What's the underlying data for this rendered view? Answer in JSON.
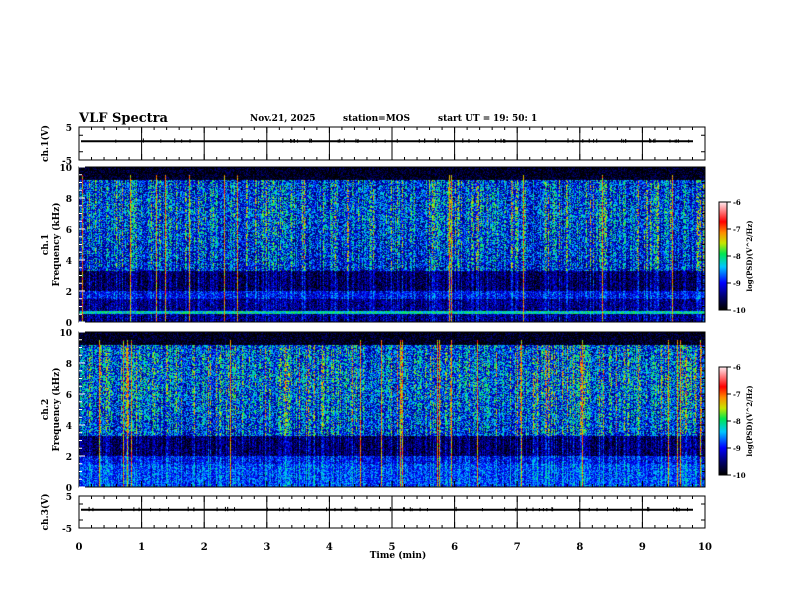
{
  "header": {
    "title": "VLF Spectra",
    "date": "Nov.21, 2025",
    "station": "station=MOS",
    "start_label": "start  UT =",
    "start_time": "19: 50: 1"
  },
  "chart_data": [
    {
      "type": "line",
      "ylabel": "ch.1(V)",
      "ylim": [
        -5,
        5
      ],
      "yticks": [
        "5",
        "-5"
      ],
      "xlim": [
        0,
        10
      ],
      "values_note_level": 0
    },
    {
      "type": "heatmap",
      "ylabel_top": "ch.1",
      "ylabel": "Frequency (kHz)",
      "ylim": [
        0,
        10
      ],
      "yticks": [
        "0",
        "2",
        "4",
        "6",
        "8",
        "10"
      ],
      "xlim": [
        0,
        10
      ],
      "colorbar": {
        "label": "log(PSD)(V^2/Hz)",
        "range": [
          -10,
          -6
        ],
        "ticks": [
          "-6",
          "-7",
          "-8",
          "-9",
          "-10"
        ]
      }
    },
    {
      "type": "heatmap",
      "ylabel_top": "ch.2",
      "ylabel": "Frequency (kHz)",
      "ylim": [
        0,
        10
      ],
      "yticks": [
        "0",
        "2",
        "4",
        "6",
        "8",
        "10"
      ],
      "xlim": [
        0,
        10
      ],
      "colorbar": {
        "label": "log(PSD)(V^2/Hz)",
        "range": [
          -10,
          -6
        ],
        "ticks": [
          "-6",
          "-7",
          "-8",
          "-9",
          "-10"
        ]
      }
    },
    {
      "type": "line",
      "ylabel": "ch.3(V)",
      "ylim": [
        -5,
        5
      ],
      "yticks": [
        "5",
        "-5"
      ],
      "xlim": [
        0,
        10
      ],
      "xlabel": "Time (min)",
      "xticks": [
        "0",
        "1",
        "2",
        "3",
        "4",
        "5",
        "6",
        "7",
        "8",
        "9",
        "10"
      ]
    }
  ]
}
